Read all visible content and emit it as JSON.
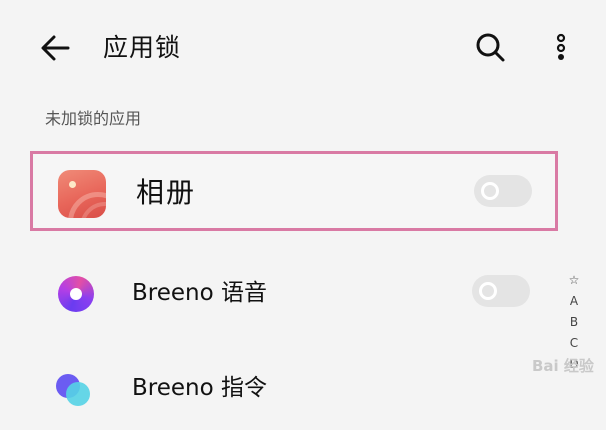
{
  "header": {
    "title": "应用锁",
    "back_icon": "arrow-left-icon",
    "search_icon": "search-icon",
    "more_icon": "more-vertical-icon"
  },
  "section": {
    "label": "未加锁的应用"
  },
  "apps": [
    {
      "name": "相册",
      "icon": "album-app-icon",
      "locked": false,
      "highlighted": true
    },
    {
      "name": "Breeno 语音",
      "icon": "breeno-voice-app-icon",
      "locked": false
    },
    {
      "name": "Breeno 指令",
      "icon": "breeno-command-app-icon"
    }
  ],
  "index_bar": {
    "items": [
      "☆",
      "A",
      "B",
      "C",
      "D"
    ]
  },
  "colors": {
    "highlight_border": "#d97aa4",
    "toggle_off": "#e4e4e4",
    "background": "#f4f4f4"
  },
  "watermark": {
    "text": "Bai 经验"
  }
}
